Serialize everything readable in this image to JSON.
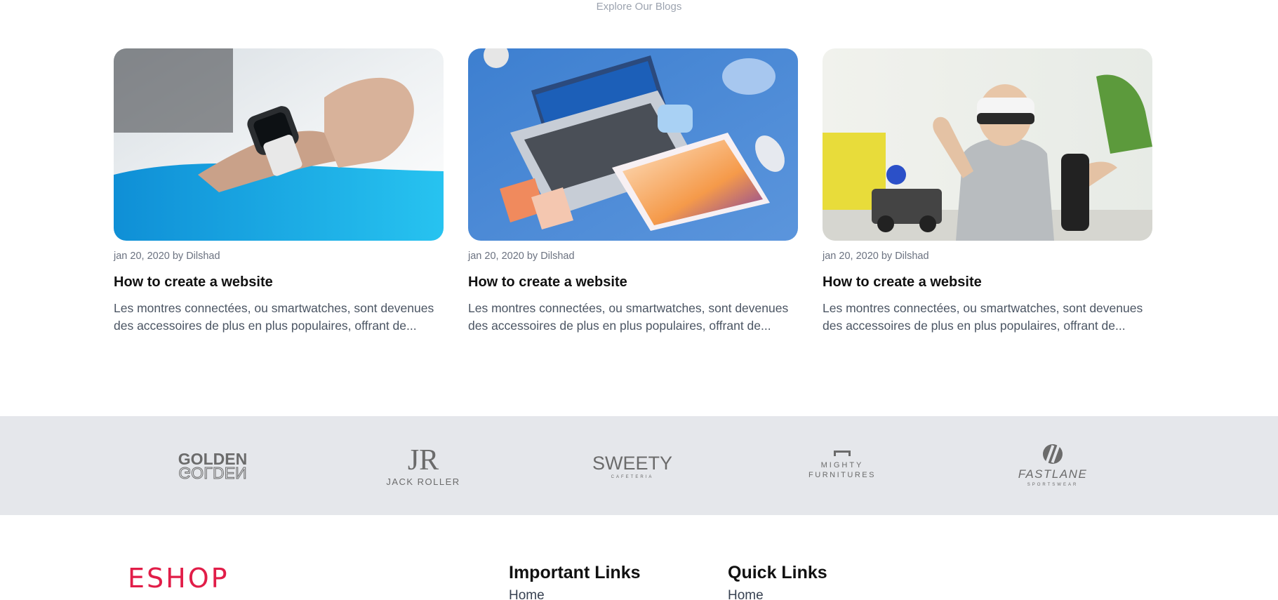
{
  "blog_section": {
    "subtitle": "Explore Our Blogs",
    "posts": [
      {
        "meta": "jan 20, 2020 by Dilshad",
        "title": "How to create a website",
        "excerpt": "Les montres connectées, ou smartwatches, sont devenues des accessoires de plus en plus populaires, offrant de...",
        "image": "smartwatch-on-wrist"
      },
      {
        "meta": "jan 20, 2020 by Dilshad",
        "title": "How to create a website",
        "excerpt": "Les montres connectées, ou smartwatches, sont devenues des accessoires de plus en plus populaires, offrant de...",
        "image": "laptop-and-phones-on-blue-desk"
      },
      {
        "meta": "jan 20, 2020 by Dilshad",
        "title": "How to create a website",
        "excerpt": "Les montres connectées, ou smartwatches, sont devenues des accessoires de plus en plus populaires, offrant de...",
        "image": "child-with-vr-headset"
      }
    ]
  },
  "brands": [
    {
      "name": "GOLDEN",
      "mirror": "GOLDEN"
    },
    {
      "name": "JACK ROLLER",
      "mark": "JR"
    },
    {
      "name": "SWEETY",
      "sub": "CAFETERIA"
    },
    {
      "name": "FURNITURES",
      "pre": "MIGHTY"
    },
    {
      "name": "FASTLANE",
      "sub": "SPORTSWEAR"
    }
  ],
  "footer": {
    "logo": "ESHOP",
    "important_links": {
      "heading": "Important Links",
      "items": [
        "Home"
      ]
    },
    "quick_links": {
      "heading": "Quick Links",
      "items": [
        "Home"
      ]
    }
  },
  "colors": {
    "brand_red": "#e11d48",
    "brand_strip": "#e5e7eb",
    "muted_text": "#6b7280"
  }
}
